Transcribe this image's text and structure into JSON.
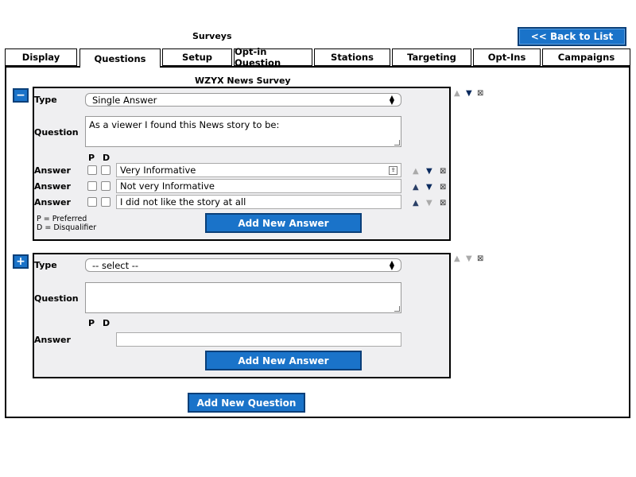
{
  "header": {
    "title": "Surveys",
    "back_label": "<< Back to List"
  },
  "tabs": [
    {
      "label": "Display"
    },
    {
      "label": "Questions"
    },
    {
      "label": "Setup"
    },
    {
      "label": "Opt-in Question"
    },
    {
      "label": "Stations"
    },
    {
      "label": "Targeting"
    },
    {
      "label": "Opt-Ins"
    },
    {
      "label": "Campaigns"
    }
  ],
  "active_tab": "Questions",
  "survey": {
    "title": "WZYX News Survey"
  },
  "question1": {
    "toggle": "−",
    "type_label": "Type",
    "type_value": "Single Answer",
    "question_label": "Question",
    "question_value": "As a viewer I found this News story to be:",
    "p_header": "P",
    "d_header": "D",
    "answers": [
      {
        "label": "Answer",
        "value": "Very Informative"
      },
      {
        "label": "Answer",
        "value": "Not very Informative"
      },
      {
        "label": "Answer",
        "value": "I did not like the story at all"
      }
    ],
    "legend_p": "P = Preferred",
    "legend_d": "D = Disqualifier",
    "add_answer_label": "Add New Answer"
  },
  "question2": {
    "toggle": "+",
    "type_label": "Type",
    "type_value": "-- select --",
    "question_label": "Question",
    "question_value": "",
    "p_header": "P",
    "d_header": "D",
    "answer_label": "Answer",
    "answer_value": "",
    "add_answer_label": "Add New Answer"
  },
  "add_question_label": "Add New Question",
  "glyphs": {
    "up": "▲",
    "down": "▼",
    "remove": "⊠",
    "select_arrows_up": "▲",
    "select_arrows_down": "▼"
  },
  "colors": {
    "accent": "#1a73c9",
    "box_bg": "#efeff1"
  }
}
